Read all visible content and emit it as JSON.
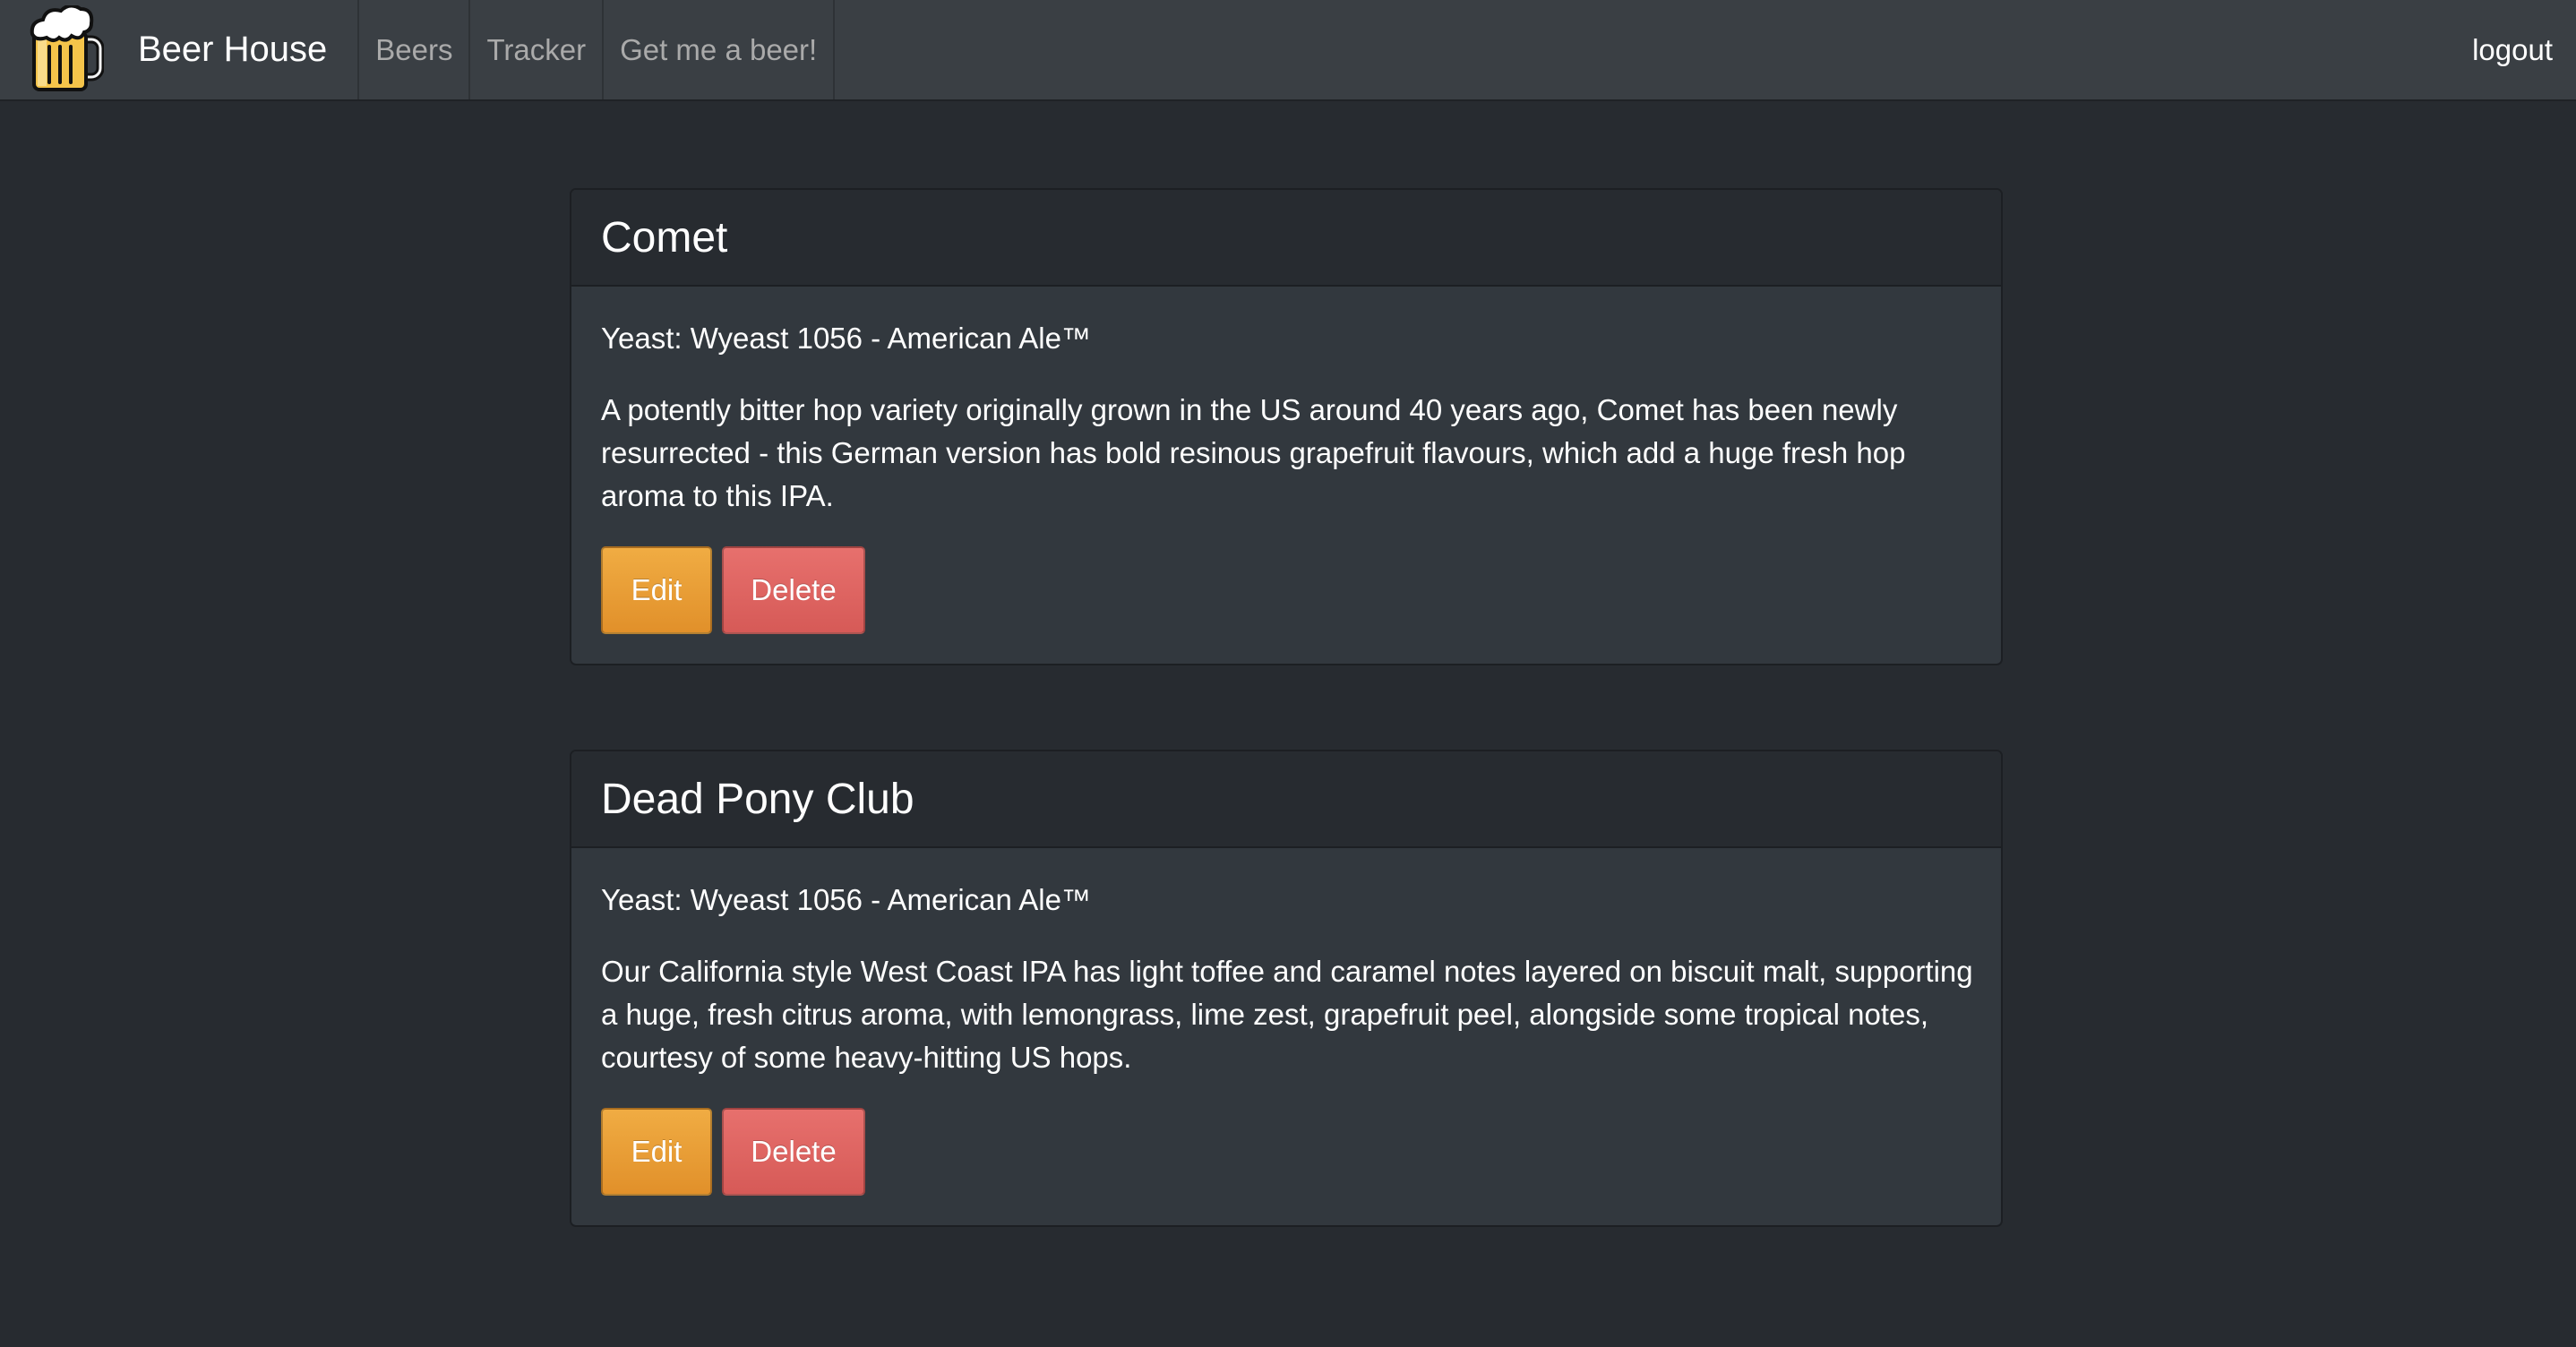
{
  "navbar": {
    "brand": "Beer House",
    "links": [
      "Beers",
      "Tracker",
      "Get me a beer!"
    ],
    "logout": "logout"
  },
  "beers": [
    {
      "name": "Comet",
      "yeast": "Yeast: Wyeast 1056 - American Ale™",
      "description": "A potently bitter hop variety originally grown in the US around 40 years ago, Comet has been newly resurrected - this German version has bold resinous grapefruit flavours, which add a huge fresh hop aroma to this IPA.",
      "edit_label": "Edit",
      "delete_label": "Delete"
    },
    {
      "name": "Dead Pony Club",
      "yeast": "Yeast: Wyeast 1056 - American Ale™",
      "description": "Our California style West Coast IPA has light toffee and caramel notes layered on biscuit malt, supporting a huge, fresh citrus aroma, with lemongrass, lime zest, grapefruit peel, alongside some tropical notes, courtesy of some heavy-hitting US hops.",
      "edit_label": "Edit",
      "delete_label": "Delete"
    }
  ],
  "colors": {
    "page_bg": "#272b30",
    "navbar_bg": "#3a3f44",
    "card_bg": "#32383e",
    "edit_button": "#e8a03a",
    "delete_button": "#de6764"
  },
  "icons": {
    "brand_logo": "beer-mug-icon"
  }
}
